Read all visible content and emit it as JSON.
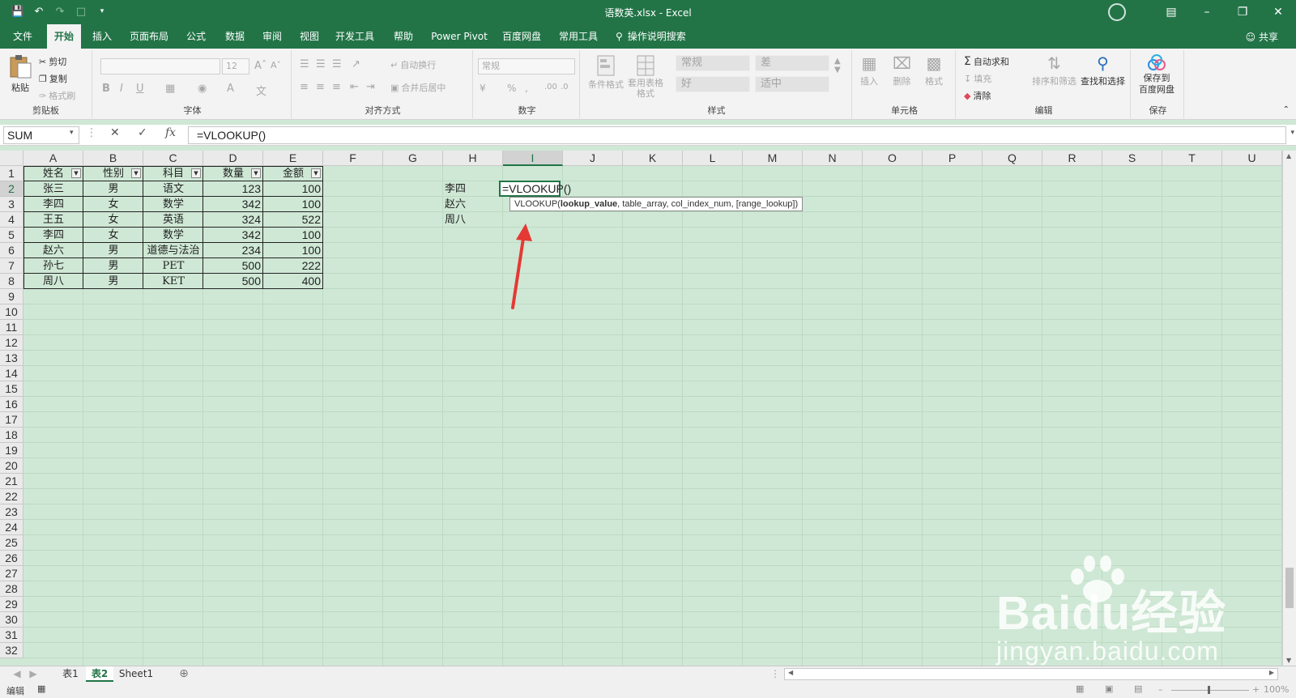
{
  "window": {
    "title": "语数英.xlsx  -  Excel"
  },
  "tabs": [
    "文件",
    "开始",
    "插入",
    "页面布局",
    "公式",
    "数据",
    "审阅",
    "视图",
    "开发工具",
    "帮助",
    "Power Pivot",
    "百度网盘",
    "常用工具"
  ],
  "tell_me": "操作说明搜索",
  "share": "共享",
  "ribbon": {
    "clipboard": {
      "paste": "粘贴",
      "cut": "剪切",
      "copy": "复制",
      "format_painter": "格式刷",
      "title": "剪贴板"
    },
    "font": {
      "size": "12",
      "title": "字体"
    },
    "alignment": {
      "wrap": "自动换行",
      "merge": "合并后居中",
      "title": "对齐方式"
    },
    "number": {
      "format": "常规",
      "title": "数字"
    },
    "styles": {
      "cond": "条件格式",
      "table": "套用表格格式",
      "normal": "常规",
      "bad": "差",
      "good": "好",
      "neutral": "适中",
      "title": "样式"
    },
    "cells": {
      "insert": "插入",
      "delete": "删除",
      "format": "格式",
      "title": "单元格"
    },
    "editing": {
      "autosum": "自动求和",
      "fill": "填充",
      "clear": "清除",
      "sort": "排序和筛选",
      "find": "查找和选择",
      "title": "编辑"
    },
    "save": {
      "label1": "保存到",
      "label2": "百度网盘",
      "title": "保存"
    }
  },
  "formula_bar": {
    "name_box": "SUM",
    "formula": "=VLOOKUP()"
  },
  "columns": [
    "A",
    "B",
    "C",
    "D",
    "E",
    "F",
    "G",
    "H",
    "I",
    "J",
    "K",
    "L",
    "M",
    "N",
    "O",
    "P",
    "Q",
    "R",
    "S",
    "T",
    "U"
  ],
  "rows": [
    "1",
    "2",
    "3",
    "4",
    "5",
    "6",
    "7",
    "8",
    "9",
    "10",
    "11",
    "12",
    "13",
    "14",
    "15",
    "16",
    "17",
    "18",
    "19",
    "20",
    "21",
    "22",
    "23",
    "24",
    "25",
    "26",
    "27",
    "28",
    "29",
    "30",
    "31",
    "32"
  ],
  "table": {
    "headers": [
      "姓名",
      "性别",
      "科目",
      "数量",
      "金额"
    ],
    "rows": [
      [
        "张三",
        "男",
        "语文",
        "123",
        "100"
      ],
      [
        "李四",
        "女",
        "数学",
        "342",
        "100"
      ],
      [
        "王五",
        "女",
        "英语",
        "324",
        "522"
      ],
      [
        "李四",
        "女",
        "数学",
        "342",
        "100"
      ],
      [
        "赵六",
        "男",
        "道德与法治",
        "234",
        "100"
      ],
      [
        "孙七",
        "男",
        "PET",
        "500",
        "222"
      ],
      [
        "周八",
        "男",
        "KET",
        "500",
        "400"
      ]
    ]
  },
  "lookup_names": [
    "李四",
    "赵六",
    "周八"
  ],
  "active_cell": {
    "text": "=VLOOKUP()"
  },
  "tooltip": {
    "fn": "VLOOKUP(",
    "arg1": "lookup_value",
    "rest": ", table_array, col_index_num, [range_lookup])"
  },
  "sheets": [
    "表1",
    "表2",
    "Sheet1"
  ],
  "status": {
    "mode": "编辑",
    "zoom": "100%"
  },
  "watermark": {
    "brand": "Baidu经验",
    "url": "jingyan.baidu.com"
  },
  "colors": {
    "excel_green": "#227447",
    "grid_bg": "#cfe8d5",
    "arrow": "#e53935"
  }
}
